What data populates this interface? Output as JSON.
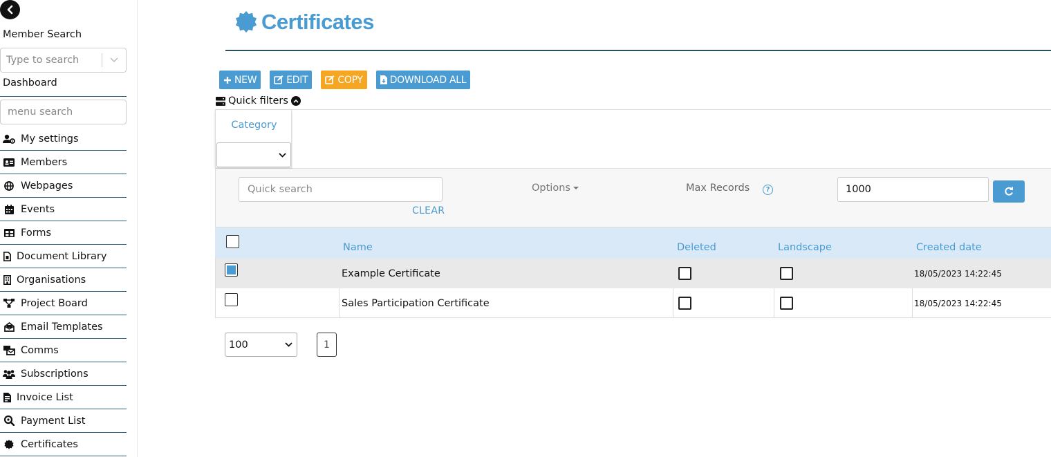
{
  "sidebar": {
    "member_search_label": "Member Search",
    "member_search_placeholder": "Type to search",
    "dashboard_label": "Dashboard",
    "menu_search_placeholder": "menu search",
    "items": [
      {
        "label": "My settings",
        "icon": "user-gear-icon"
      },
      {
        "label": "Members",
        "icon": "id-card-icon"
      },
      {
        "label": "Webpages",
        "icon": "globe-icon"
      },
      {
        "label": "Events",
        "icon": "calendar-icon"
      },
      {
        "label": "Forms",
        "icon": "table-icon"
      },
      {
        "label": "Document Library",
        "icon": "file-icon"
      },
      {
        "label": "Organisations",
        "icon": "building-icon"
      },
      {
        "label": "Project Board",
        "icon": "sitemap-icon"
      },
      {
        "label": "Email Templates",
        "icon": "envelope-open-icon"
      },
      {
        "label": "Comms",
        "icon": "mail-bulk-icon"
      },
      {
        "label": "Subscriptions",
        "icon": "users-icon"
      },
      {
        "label": "Invoice List",
        "icon": "invoice-icon"
      },
      {
        "label": "Payment List",
        "icon": "search-dollar-icon"
      },
      {
        "label": "Certificates",
        "icon": "certificate-icon"
      }
    ]
  },
  "header": {
    "title": "Certificates",
    "icon": "certificate-icon"
  },
  "toolbar": {
    "new_label": "NEW",
    "edit_label": "EDIT",
    "copy_label": "COPY",
    "download_label": "DOWNLOAD ALL"
  },
  "quick_filters": {
    "label": "Quick filters",
    "category_label": "Category",
    "category_value": ""
  },
  "search": {
    "placeholder": "Quick search",
    "clear_label": "CLEAR",
    "options_label": "Options",
    "max_records_label": "Max Records",
    "max_records_value": "1000"
  },
  "table": {
    "columns": [
      "Name",
      "Deleted",
      "Landscape",
      "Created date"
    ],
    "rows": [
      {
        "selected": true,
        "name": "Example Certificate",
        "deleted": false,
        "landscape": false,
        "created": "18/05/2023 14:22:45"
      },
      {
        "selected": false,
        "name": "Sales Participation Certificate",
        "deleted": false,
        "landscape": false,
        "created": "18/05/2023 14:22:45"
      }
    ]
  },
  "pager": {
    "page_size": "100",
    "current_page": "1"
  },
  "colors": {
    "accent": "#4a9bd1",
    "warning": "#f5a623",
    "header_bg": "#d9e9f7",
    "rule": "#2c5f78"
  }
}
